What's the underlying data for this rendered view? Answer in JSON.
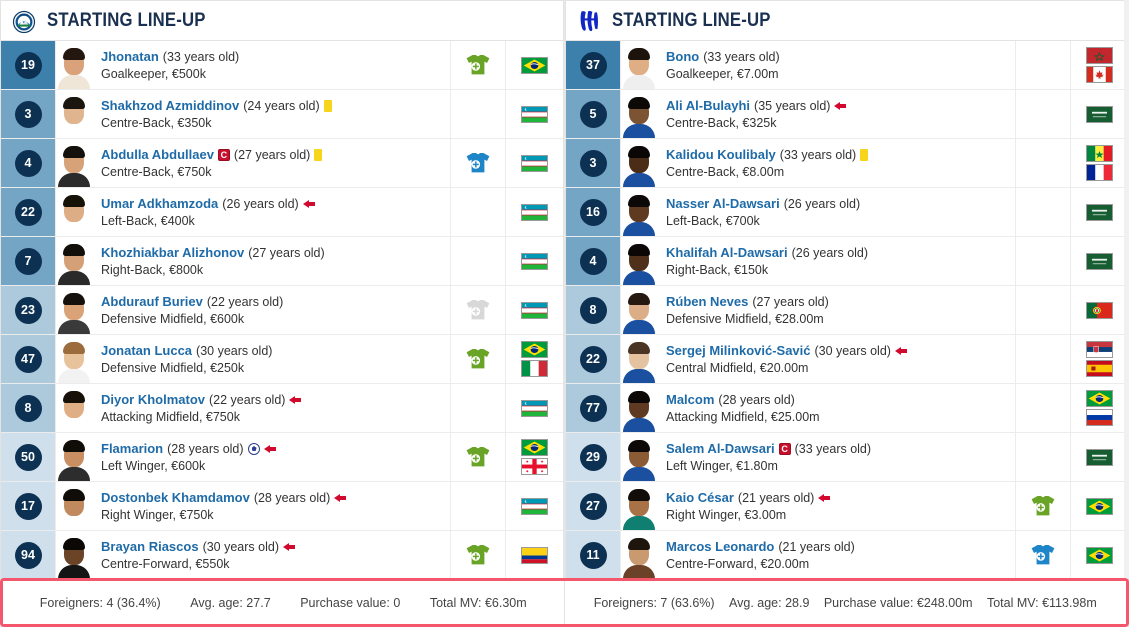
{
  "left": {
    "header": {
      "title": "STARTING LINE-UP",
      "badge_name": "pakhtakor-crest-icon"
    },
    "players": [
      {
        "number": "19",
        "name": "Jhonatan",
        "age": "(33 years old)",
        "detail": "Goalkeeper, €500k",
        "group": "gk",
        "captain": false,
        "yellow": false,
        "goal": false,
        "subout": false,
        "sub_icon": "green",
        "flags": [
          "br"
        ],
        "skin": "#d9a27a",
        "hair": "#23170f",
        "shirt": "#f0e6d8"
      },
      {
        "number": "3",
        "name": "Shakhzod Azmiddinov",
        "age": "(24 years old)",
        "detail": "Centre-Back, €350k",
        "group": "def",
        "captain": false,
        "yellow": true,
        "goal": false,
        "subout": false,
        "sub_icon": "none",
        "flags": [
          "uz"
        ],
        "skin": "#e0b48e",
        "hair": "#1b1510",
        "shirt": "#ffffff"
      },
      {
        "number": "4",
        "name": "Abdulla Abdullaev",
        "age": "(27 years old)",
        "detail": "Centre-Back, €750k",
        "group": "def",
        "captain": true,
        "yellow": true,
        "goal": false,
        "subout": false,
        "sub_icon": "blue",
        "flags": [
          "uz"
        ],
        "skin": "#d7a277",
        "hair": "#14100c",
        "shirt": "#2b2b2b"
      },
      {
        "number": "22",
        "name": "Umar Adkhamzoda",
        "age": "(26 years old)",
        "detail": "Left-Back, €400k",
        "group": "def",
        "captain": false,
        "yellow": false,
        "goal": false,
        "subout": true,
        "sub_icon": "none",
        "flags": [
          "uz"
        ],
        "skin": "#ddae85",
        "hair": "#171208",
        "shirt": "#ffffff"
      },
      {
        "number": "7",
        "name": "Khozhiakbar Alizhonov",
        "age": "(27 years old)",
        "detail": "Right-Back, €800k",
        "group": "def",
        "captain": false,
        "yellow": false,
        "goal": false,
        "subout": false,
        "sub_icon": "none",
        "flags": [
          "uz"
        ],
        "skin": "#d4a077",
        "hair": "#120e0a",
        "shirt": "#2a2a2a"
      },
      {
        "number": "23",
        "name": "Abdurauf Buriev",
        "age": "(22 years old)",
        "detail": "Defensive Midfield, €600k",
        "group": "mid",
        "captain": false,
        "yellow": false,
        "goal": false,
        "subout": false,
        "sub_icon": "grey",
        "flags": [
          "uz"
        ],
        "skin": "#d9a377",
        "hair": "#15100b",
        "shirt": "#3a3a3a"
      },
      {
        "number": "47",
        "name": "Jonatan Lucca",
        "age": "(30 years old)",
        "detail": "Defensive Midfield, €250k",
        "group": "mid",
        "captain": false,
        "yellow": false,
        "goal": false,
        "subout": false,
        "sub_icon": "green",
        "flags": [
          "br",
          "it"
        ],
        "skin": "#e8c29a",
        "hair": "#9c6b3c",
        "shirt": "#f2f2f2"
      },
      {
        "number": "8",
        "name": "Diyor Kholmatov",
        "age": "(22 years old)",
        "detail": "Attacking Midfield, €750k",
        "group": "mid",
        "captain": false,
        "yellow": false,
        "goal": false,
        "subout": true,
        "sub_icon": "none",
        "flags": [
          "uz"
        ],
        "skin": "#dfae84",
        "hair": "#171009",
        "shirt": "#ffffff"
      },
      {
        "number": "50",
        "name": "Flamarion",
        "age": "(28 years old)",
        "detail": "Left Winger, €600k",
        "group": "fwd",
        "captain": false,
        "yellow": false,
        "goal": true,
        "subout": true,
        "sub_icon": "green",
        "flags": [
          "br",
          "ge"
        ],
        "skin": "#c98f63",
        "hair": "#100d09",
        "shirt": "#2d2d2d"
      },
      {
        "number": "17",
        "name": "Dostonbek Khamdamov",
        "age": "(28 years old)",
        "detail": "Right Winger, €750k",
        "group": "fwd",
        "captain": false,
        "yellow": false,
        "goal": false,
        "subout": true,
        "sub_icon": "none",
        "flags": [
          "uz"
        ],
        "skin": "#c08a5e",
        "hair": "#100c08",
        "shirt": "#ffffff"
      },
      {
        "number": "94",
        "name": "Brayan Riascos",
        "age": "(30 years old)",
        "detail": "Centre-Forward, €550k",
        "group": "fwd",
        "captain": false,
        "yellow": false,
        "goal": false,
        "subout": true,
        "sub_icon": "green",
        "flags": [
          "co"
        ],
        "skin": "#6b4326",
        "hair": "#0b0806",
        "shirt": "#141414"
      }
    ],
    "footer": {
      "foreigners": "Foreigners: 4 (36.4%)",
      "avg_age": "Avg. age: 27.7",
      "purchase_value": "Purchase value: 0",
      "total_mv": "Total MV: €6.30m"
    }
  },
  "right": {
    "header": {
      "title": "STARTING LINE-UP",
      "badge_name": "al-hilal-crest-icon"
    },
    "players": [
      {
        "number": "37",
        "name": "Bono",
        "age": "(33 years old)",
        "detail": "Goalkeeper, €7.00m",
        "group": "gk",
        "captain": false,
        "yellow": false,
        "goal": false,
        "subout": false,
        "sub_icon": "none",
        "flags": [
          "ma",
          "ca"
        ],
        "skin": "#dfae84",
        "hair": "#1c140c",
        "shirt": "#efefef"
      },
      {
        "number": "5",
        "name": "Ali Al-Bulayhi",
        "age": "(35 years old)",
        "detail": "Centre-Back, €325k",
        "group": "def",
        "captain": false,
        "yellow": false,
        "goal": false,
        "subout": true,
        "sub_icon": "none",
        "flags": [
          "sa"
        ],
        "skin": "#7d5433",
        "hair": "#0d0907",
        "shirt": "#1b4fa0"
      },
      {
        "number": "3",
        "name": "Kalidou Koulibaly",
        "age": "(33 years old)",
        "detail": "Centre-Back, €8.00m",
        "group": "def",
        "captain": false,
        "yellow": true,
        "goal": false,
        "subout": false,
        "sub_icon": "none",
        "flags": [
          "sn",
          "fr"
        ],
        "skin": "#4a2c17",
        "hair": "#0a0706",
        "shirt": "#1b4fa0"
      },
      {
        "number": "16",
        "name": "Nasser Al-Dawsari",
        "age": "(26 years old)",
        "detail": "Left-Back, €700k",
        "group": "def",
        "captain": false,
        "yellow": false,
        "goal": false,
        "subout": false,
        "sub_icon": "none",
        "flags": [
          "sa"
        ],
        "skin": "#5d3a20",
        "hair": "#0b0807",
        "shirt": "#1b4fa0"
      },
      {
        "number": "4",
        "name": "Khalifah Al-Dawsari",
        "age": "(26 years old)",
        "detail": "Right-Back, €150k",
        "group": "def",
        "captain": false,
        "yellow": false,
        "goal": false,
        "subout": false,
        "sub_icon": "none",
        "flags": [
          "sa"
        ],
        "skin": "#4f301a",
        "hair": "#0a0706",
        "shirt": "#1b4fa0"
      },
      {
        "number": "8",
        "name": "Rúben Neves",
        "age": "(27 years old)",
        "detail": "Defensive Midfield, €28.00m",
        "group": "mid",
        "captain": false,
        "yellow": false,
        "goal": false,
        "subout": false,
        "sub_icon": "none",
        "flags": [
          "pt"
        ],
        "skin": "#dcae87",
        "hair": "#241810",
        "shirt": "#1b4fa0"
      },
      {
        "number": "22",
        "name": "Sergej Milinković-Savić",
        "age": "(30 years old)",
        "detail": "Central Midfield, €20.00m",
        "group": "mid",
        "captain": false,
        "yellow": false,
        "goal": false,
        "subout": true,
        "sub_icon": "none",
        "flags": [
          "rs",
          "es"
        ],
        "skin": "#e6c3a0",
        "hair": "#4a3524",
        "shirt": "#1b4fa0"
      },
      {
        "number": "77",
        "name": "Malcom",
        "age": "(28 years old)",
        "detail": "Attacking Midfield, €25.00m",
        "group": "mid",
        "captain": false,
        "yellow": false,
        "goal": false,
        "subout": false,
        "sub_icon": "none",
        "flags": [
          "br",
          "ru"
        ],
        "skin": "#5e3a22",
        "hair": "#0b0807",
        "shirt": "#1b4fa0"
      },
      {
        "number": "29",
        "name": "Salem Al-Dawsari",
        "age": "(33 years old)",
        "detail": "Left Winger, €1.80m",
        "group": "fwd",
        "captain": true,
        "yellow": false,
        "goal": false,
        "subout": false,
        "sub_icon": "none",
        "flags": [
          "sa"
        ],
        "skin": "#8a5b35",
        "hair": "#0d0908",
        "shirt": "#1b4fa0"
      },
      {
        "number": "27",
        "name": "Kaio César",
        "age": "(21 years old)",
        "detail": "Right Winger, €3.00m",
        "group": "fwd",
        "captain": false,
        "yellow": false,
        "goal": false,
        "subout": true,
        "sub_icon": "green",
        "flags": [
          "br"
        ],
        "skin": "#a97246",
        "hair": "#120d09",
        "shirt": "#0f7f72"
      },
      {
        "number": "11",
        "name": "Marcos Leonardo",
        "age": "(21 years old)",
        "detail": "Centre-Forward, €20.00m",
        "group": "fwd",
        "captain": false,
        "yellow": false,
        "goal": false,
        "subout": false,
        "sub_icon": "blue",
        "flags": [
          "br"
        ],
        "skin": "#c99a6f",
        "hair": "#1e150d",
        "shirt": "#6b4128"
      }
    ],
    "footer": {
      "foreigners": "Foreigners: 7 (63.6%)",
      "avg_age": "Avg. age: 28.9",
      "purchase_value": "Purchase value: €248.00m",
      "total_mv": "Total MV: €113.98m"
    }
  },
  "colors": {
    "gk_bg": "#3d80ab",
    "def_bg": "#74a5c4",
    "mid_bg": "#adc9dc",
    "fwd_bg": "#cfe0ec",
    "number_badge": "#0c3152",
    "player_link": "#1e6ba8",
    "sub_in_green": "#6aa426",
    "sub_in_blue": "#1e86c8",
    "sub_grey": "#d8d8d8",
    "highlight_border": "#f4566b",
    "yellow_card": "#f7d51d",
    "red_arrow": "#d2092e"
  }
}
